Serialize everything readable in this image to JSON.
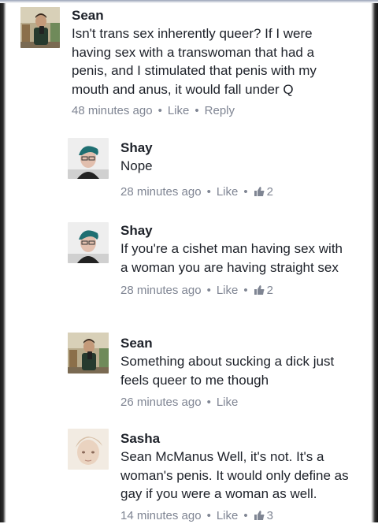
{
  "comments": [
    {
      "author": "Sean",
      "text": "Isn't trans sex inherently queer? If I were having sex with a transwoman that had a penis, and I stimulated that penis with my mouth and anus, it would fall under Q",
      "time": "48 minutes ago",
      "like_label": "Like",
      "reply_label": "Reply",
      "avatar": "sean-photo"
    },
    {
      "author": "Shay",
      "text": "Nope",
      "time": "28 minutes ago",
      "like_label": "Like",
      "like_count": "2",
      "avatar": "shay-photo"
    },
    {
      "author": "Shay",
      "text": "If you're a cishet man having sex with a woman you are having straight sex",
      "time": "28 minutes ago",
      "like_label": "Like",
      "like_count": "2",
      "avatar": "shay-photo"
    },
    {
      "author": "Sean",
      "text": "Something about sucking a dick just feels queer to me though",
      "time": "26 minutes ago",
      "like_label": "Like",
      "avatar": "sean-photo"
    },
    {
      "author": "Sasha",
      "text": "Sean McManus Well, it's not. It's a woman's penis. It would only define as gay if you were a woman as well.",
      "time": "14 minutes ago",
      "like_label": "Like",
      "like_count": "3",
      "avatar": "sasha-photo"
    }
  ],
  "icons": {
    "like_count_icon": "thumbs-up-icon",
    "separator": "•"
  },
  "colors": {
    "name_text": "#1d2129",
    "meta_text": "#7f8593",
    "like_icon": "#7f8593"
  }
}
